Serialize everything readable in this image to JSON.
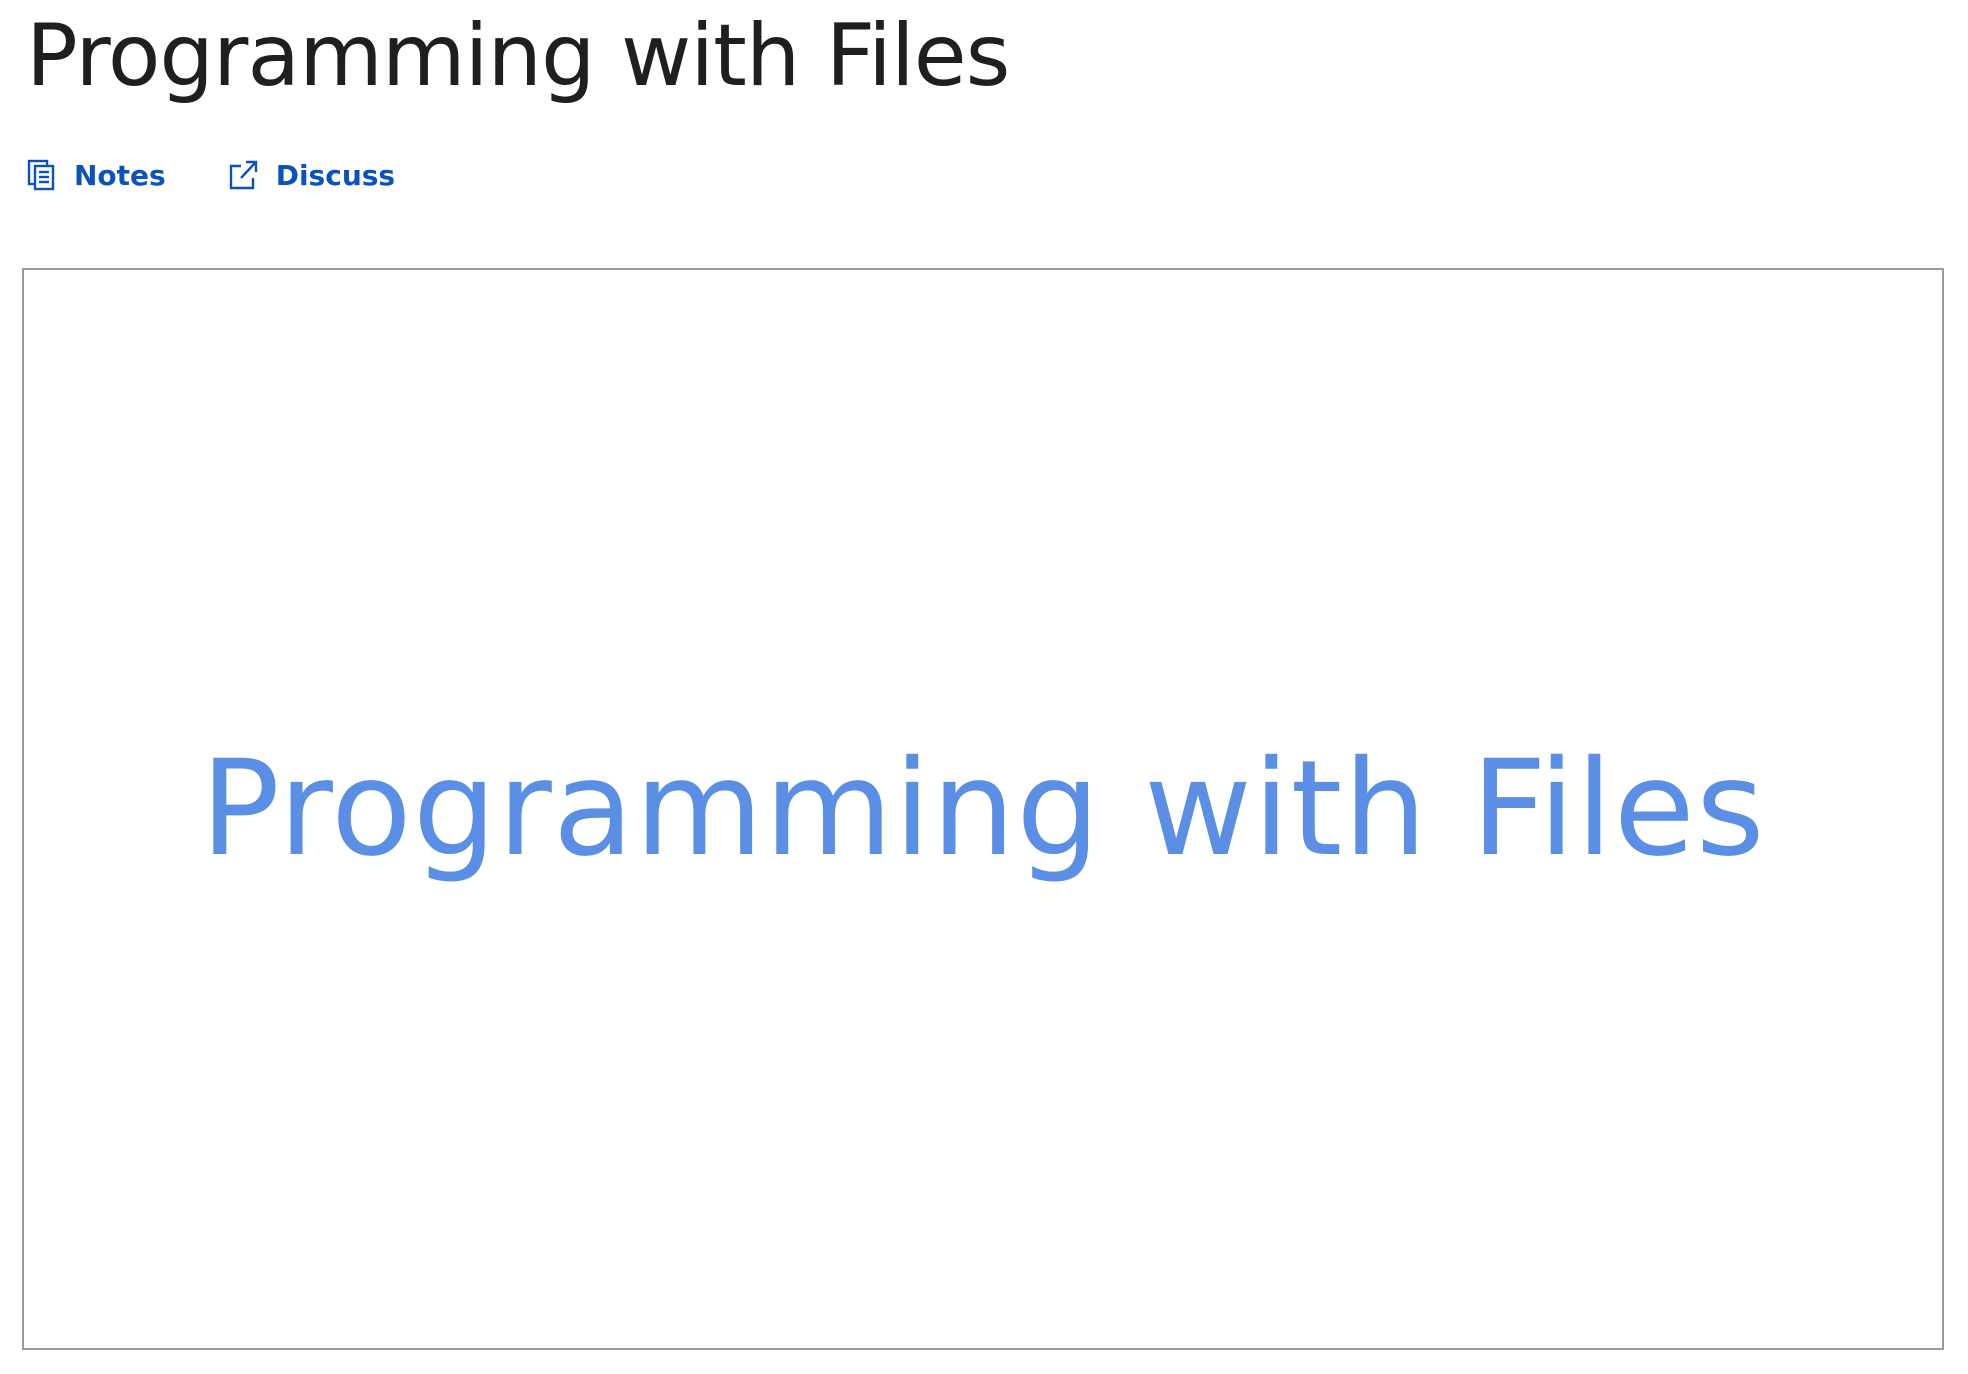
{
  "page": {
    "title": "Programming with Files"
  },
  "actions": {
    "notes_label": "Notes",
    "discuss_label": "Discuss",
    "notes_icon": "notes-icon",
    "discuss_icon": "external-link-icon"
  },
  "video": {
    "slide_text": "Programming with Files"
  },
  "colors": {
    "link": "#0a53be",
    "slide_text": "#5b8fe6",
    "title_text": "#1f1f1f",
    "frame_border": "#9a9a9a"
  }
}
